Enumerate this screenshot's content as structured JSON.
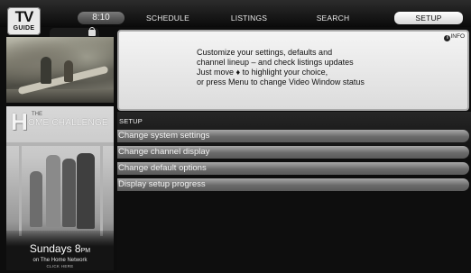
{
  "logo": {
    "line1": "TV",
    "line2": "GUIDE"
  },
  "header": {
    "time": "8:10",
    "tabs": [
      {
        "label": "SCHEDULE",
        "active": false
      },
      {
        "label": "LISTINGS",
        "active": false
      },
      {
        "label": "SEARCH",
        "active": false
      },
      {
        "label": "SETUP",
        "active": true
      }
    ]
  },
  "ad": {
    "the": "THE",
    "h": "H",
    "title": "OME CHALLENGE",
    "airtime": "Sundays 8",
    "airtime_suffix": "PM",
    "network": "on The Home Network",
    "cta": "CLICK HERE"
  },
  "info": {
    "badge": "INFO",
    "lines": [
      "Customize your settings, defaults and",
      "channel lineup – and check listings updates",
      "Just move ♦ to highlight your choice,",
      "or press Menu to change Video Window status"
    ]
  },
  "setup": {
    "section_label": "SETUP",
    "items": [
      {
        "label": "Change system settings"
      },
      {
        "label": "Change channel display"
      },
      {
        "label": "Change default options"
      },
      {
        "label": "Display setup progress"
      }
    ]
  }
}
